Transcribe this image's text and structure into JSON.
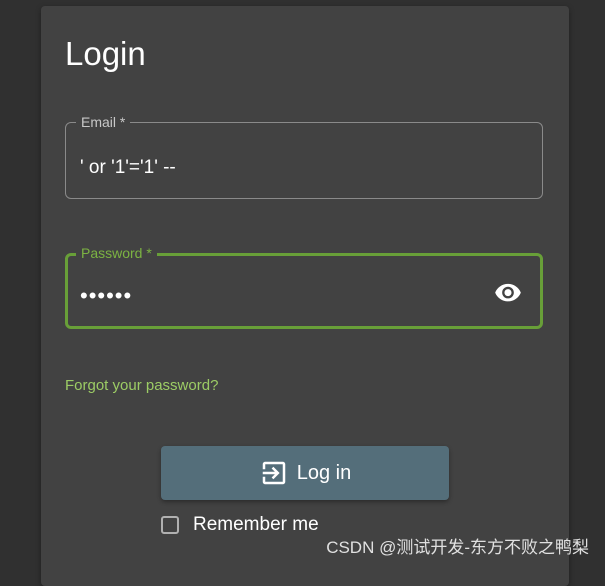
{
  "login_card": {
    "title": "Login",
    "email": {
      "label": "Email *",
      "value": "' or '1'='1' --"
    },
    "password": {
      "label": "Password *",
      "masked_value": "••••••",
      "visibility_icon": "eye-icon"
    },
    "forgot_password_link": "Forgot your password?",
    "login_button": {
      "label": "Log in",
      "icon": "login-icon"
    },
    "remember_me": {
      "label": "Remember me",
      "checked": false
    }
  },
  "watermark": "CSDN @测试开发-东方不败之鸭梨",
  "colors": {
    "background": "#303030",
    "card": "#424242",
    "accent_green": "#689f38",
    "link_green": "#9ccc65",
    "button": "#546e7a"
  }
}
